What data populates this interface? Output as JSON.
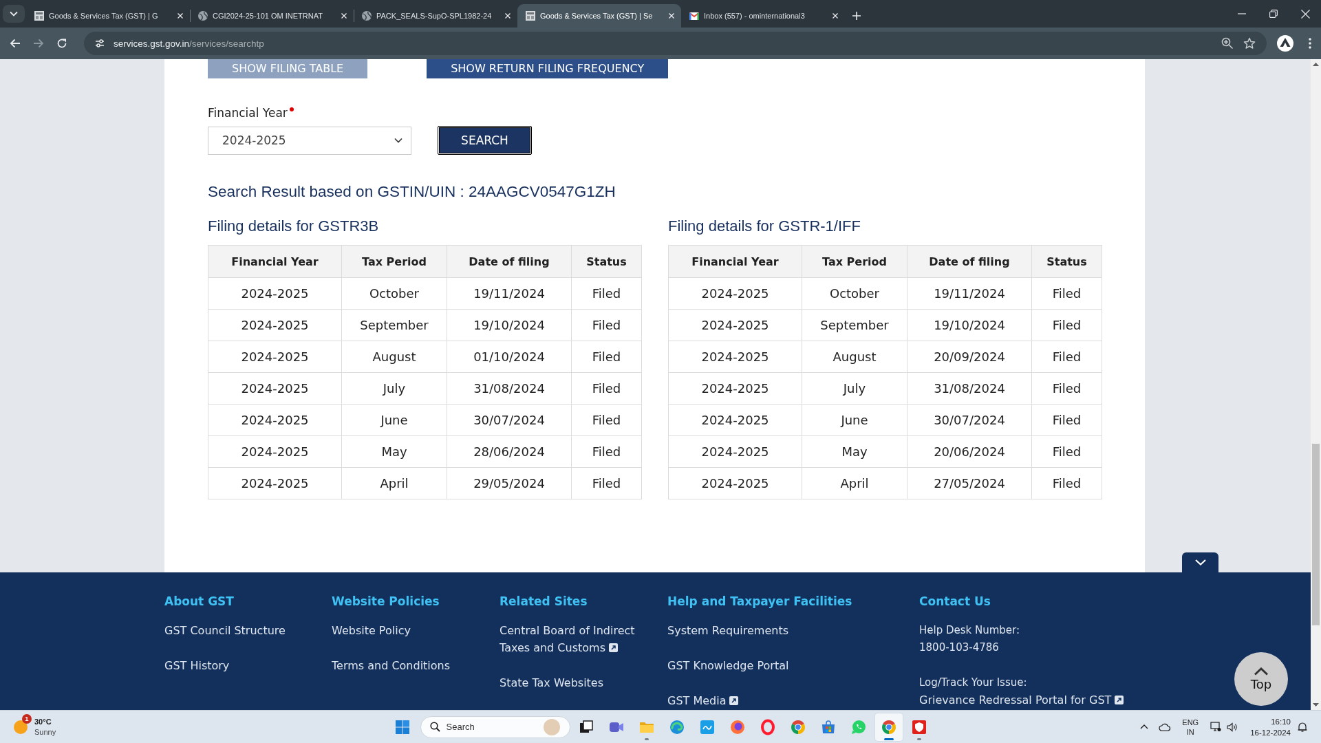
{
  "browser": {
    "tabs": [
      {
        "kind": "emblem",
        "title": "Goods & Services Tax (GST) | G",
        "selected": false
      },
      {
        "kind": "globe",
        "title": "CGI2024-25-101 OM INETRNAT",
        "selected": false
      },
      {
        "kind": "globe",
        "title": "PACK_SEALS-SupO-SPL1982-24",
        "selected": false
      },
      {
        "kind": "emblem",
        "title": "Goods & Services Tax (GST) | Se",
        "selected": true
      },
      {
        "kind": "mail",
        "title": "Inbox (557) - ominternational3",
        "selected": false
      }
    ],
    "nav_buttons": [
      {
        "kind": "back",
        "disabled": false
      },
      {
        "kind": "forward",
        "disabled": true
      },
      {
        "kind": "reload",
        "disabled": false
      }
    ],
    "address": {
      "host": "services.gst.gov.in",
      "path": "/services/searchtp"
    }
  },
  "page": {
    "view_buttons": [
      {
        "label": "SHOW FILING TABLE",
        "disabled": true
      },
      {
        "label": "SHOW RETURN FILING FREQUENCY",
        "disabled": false
      }
    ],
    "financial_year": {
      "label": "Financial Year",
      "required": true,
      "value": "2024-2025"
    },
    "search_button": {
      "label": "SEARCH"
    },
    "result_heading": "Search Result based on GSTIN/UIN : 24AAGCV0547G1ZH",
    "tables": [
      {
        "title": "Filing details for GSTR3B",
        "columns": [
          "Financial Year",
          "Tax Period",
          "Date of filing",
          "Status"
        ],
        "rows": [
          [
            "2024-2025",
            "October",
            "19/11/2024",
            "Filed"
          ],
          [
            "2024-2025",
            "September",
            "19/10/2024",
            "Filed"
          ],
          [
            "2024-2025",
            "August",
            "01/10/2024",
            "Filed"
          ],
          [
            "2024-2025",
            "July",
            "31/08/2024",
            "Filed"
          ],
          [
            "2024-2025",
            "June",
            "30/07/2024",
            "Filed"
          ],
          [
            "2024-2025",
            "May",
            "28/06/2024",
            "Filed"
          ],
          [
            "2024-2025",
            "April",
            "29/05/2024",
            "Filed"
          ]
        ]
      },
      {
        "title": "Filing details for GSTR-1/IFF",
        "columns": [
          "Financial Year",
          "Tax Period",
          "Date of filing",
          "Status"
        ],
        "rows": [
          [
            "2024-2025",
            "October",
            "19/11/2024",
            "Filed"
          ],
          [
            "2024-2025",
            "September",
            "19/10/2024",
            "Filed"
          ],
          [
            "2024-2025",
            "August",
            "20/09/2024",
            "Filed"
          ],
          [
            "2024-2025",
            "July",
            "31/08/2024",
            "Filed"
          ],
          [
            "2024-2025",
            "June",
            "30/07/2024",
            "Filed"
          ],
          [
            "2024-2025",
            "May",
            "20/06/2024",
            "Filed"
          ],
          [
            "2024-2025",
            "April",
            "27/05/2024",
            "Filed"
          ]
        ]
      }
    ]
  },
  "footer": {
    "columns": [
      {
        "heading": "About GST",
        "items": [
          {
            "kind": "link",
            "text": "GST Council Structure",
            "external": false
          },
          {
            "kind": "link",
            "text": "GST History",
            "external": false
          }
        ]
      },
      {
        "heading": "Website Policies",
        "items": [
          {
            "kind": "link",
            "text": "Website Policy",
            "external": false
          },
          {
            "kind": "link",
            "text": "Terms and Conditions",
            "external": false
          }
        ]
      },
      {
        "heading": "Related Sites",
        "items": [
          {
            "kind": "link",
            "text": "Central Board of Indirect Taxes and Customs",
            "external": true
          },
          {
            "kind": "link",
            "text": "State Tax Websites",
            "external": false
          }
        ]
      },
      {
        "heading": "Help and Taxpayer Facilities",
        "items": [
          {
            "kind": "link",
            "text": "System Requirements",
            "external": false
          },
          {
            "kind": "link",
            "text": "GST Knowledge Portal",
            "external": false
          },
          {
            "kind": "link",
            "text": "GST Media",
            "external": true
          }
        ]
      },
      {
        "heading": "Contact Us",
        "items": [
          {
            "kind": "contact",
            "label": "Help Desk Number:",
            "value": "1800-103-4786",
            "external": false
          },
          {
            "kind": "contact",
            "label": "Log/Track Your Issue:",
            "value": "Grievance Redressal Portal for GST",
            "external": true
          }
        ]
      }
    ],
    "top_button": {
      "label": "Top"
    }
  },
  "taskbar": {
    "weather": {
      "temperature": "30°C",
      "condition": "Sunny",
      "badge": "1"
    },
    "search": {
      "placeholder": "Search"
    },
    "apps": [
      {
        "kind": "taskview",
        "running": false,
        "selected": false
      },
      {
        "kind": "meet",
        "running": false,
        "selected": false
      },
      {
        "kind": "explorer",
        "running": true,
        "selected": false
      },
      {
        "kind": "edge",
        "running": false,
        "selected": false
      },
      {
        "kind": "myhp",
        "running": false,
        "selected": false
      },
      {
        "kind": "firefox",
        "running": false,
        "selected": false
      },
      {
        "kind": "opera",
        "running": false,
        "selected": false
      },
      {
        "kind": "chrome",
        "running": false,
        "selected": false
      },
      {
        "kind": "store",
        "running": false,
        "selected": false
      },
      {
        "kind": "whatsapp",
        "running": false,
        "selected": false
      },
      {
        "kind": "chrome",
        "running": true,
        "selected": true
      },
      {
        "kind": "mcafee",
        "running": true,
        "selected": false
      }
    ],
    "tray": {
      "language": "ENG",
      "region": "IN",
      "time": "16:10",
      "date": "16-12-2024"
    }
  }
}
